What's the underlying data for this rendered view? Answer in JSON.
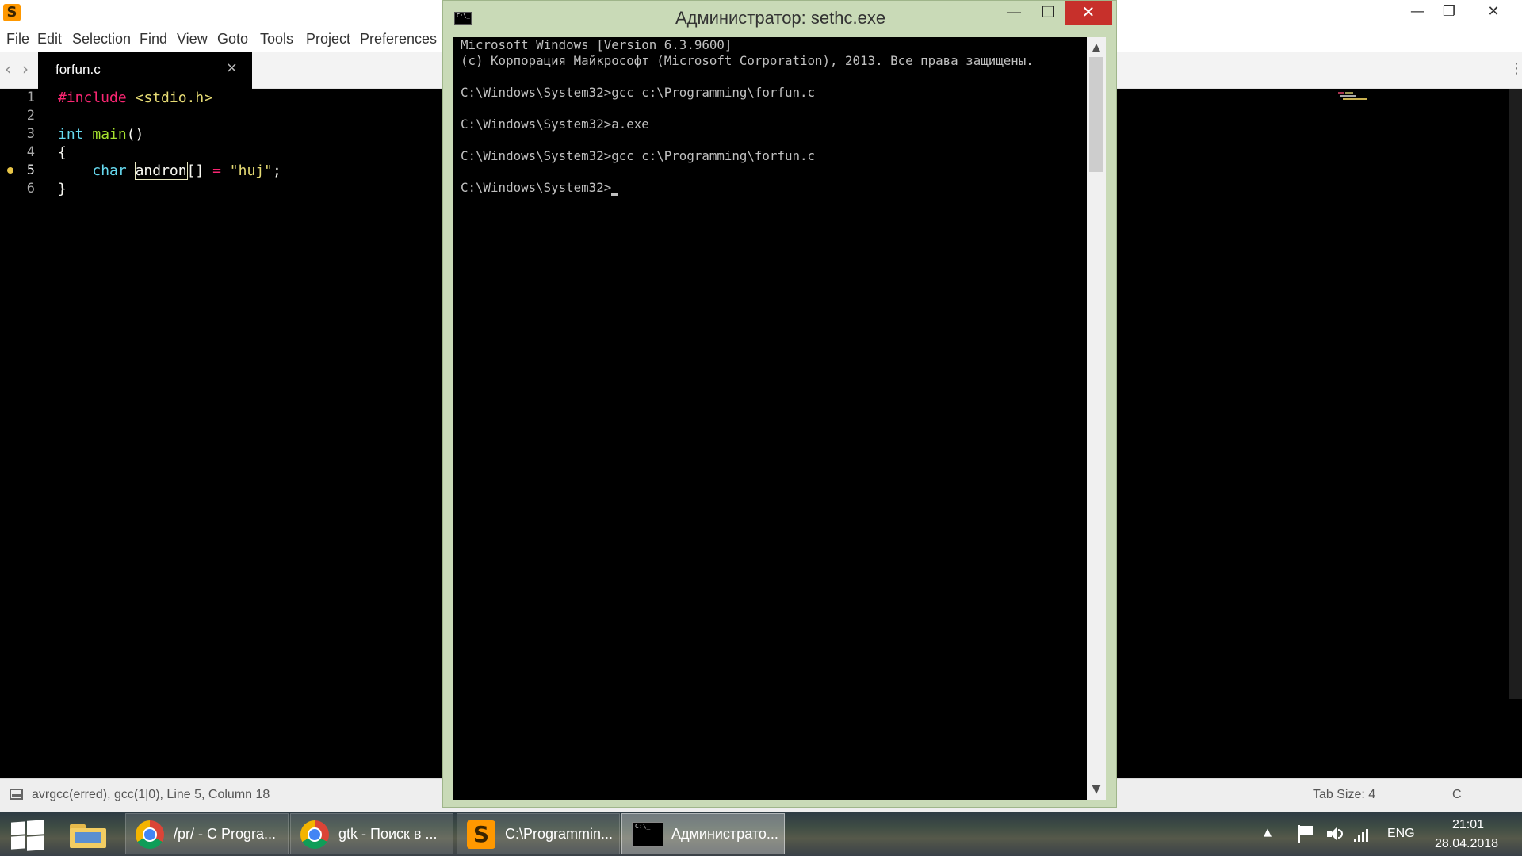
{
  "editor": {
    "menu": [
      "File",
      "Edit",
      "Selection",
      "Find",
      "View",
      "Goto",
      "Tools",
      "Project",
      "Preferences"
    ],
    "window_controls": {
      "minimize": "—",
      "restore": "❐",
      "close": "✕"
    },
    "tab": {
      "label": "forfun.c",
      "close": "×"
    },
    "nav": {
      "back": "‹",
      "forward": "›"
    },
    "tab_menu": "⋮",
    "line_numbers": [
      "1",
      "2",
      "3",
      "4",
      "5",
      "6"
    ],
    "active_line": "5",
    "code": {
      "l1_directive": "#include",
      "l1_header": " <stdio.h>",
      "l3_type": "int",
      "l3_func": " main",
      "l3_rest": "()",
      "l4": "{",
      "l5_indent": "    ",
      "l5_type": "char",
      "l5_space": " ",
      "l5_ident": "andron",
      "l5_brackets": "[] ",
      "l5_op": "=",
      "l5_space2": " ",
      "l5_str": "\"huj\"",
      "l5_semi": ";",
      "l6": "}"
    },
    "status": {
      "text": "avrgcc(erred), gcc(1|0), Line 5, Column 18",
      "tab_size": "Tab Size: 4",
      "syntax": "C"
    },
    "colors": {
      "keyword": "#f92672",
      "type": "#66d9ef",
      "function": "#a6e22e",
      "string": "#e6db74"
    }
  },
  "console": {
    "title": "Администратор: sethc.exe",
    "icon_text": "C:\\_",
    "controls": {
      "minimize": "—",
      "maximize": "☐",
      "close": "✕"
    },
    "lines": [
      "Microsoft Windows [Version 6.3.9600]",
      "(c) Корпорация Майкрософт (Microsoft Corporation), 2013. Все права защищены.",
      "",
      "C:\\Windows\\System32>gcc c:\\Programming\\forfun.c",
      "",
      "C:\\Windows\\System32>a.exe",
      "",
      "C:\\Windows\\System32>gcc c:\\Programming\\forfun.c",
      "",
      "C:\\Windows\\System32>"
    ],
    "scroll_up": "▲",
    "scroll_down": "▼"
  },
  "taskbar": {
    "buttons": [
      {
        "label": "/pr/ - C Progra..."
      },
      {
        "label": "gtk - Поиск в ..."
      },
      {
        "label": "C:\\Programmin..."
      },
      {
        "label": "Администрато..."
      }
    ],
    "tray": {
      "chevron": "▲",
      "language": "ENG",
      "time": "21:01",
      "date": "28.04.2018"
    }
  }
}
